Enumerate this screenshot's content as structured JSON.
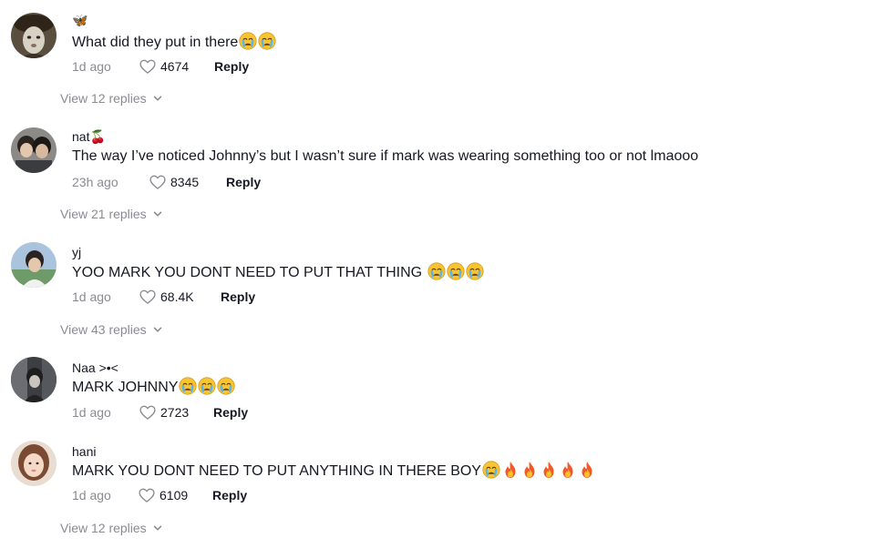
{
  "comments": [
    {
      "username": "🦋",
      "text": "What did they put in there",
      "emojis": [
        "cry-face",
        "cry-face"
      ],
      "time": "1d ago",
      "likes": "4674",
      "reply_label": "Reply",
      "view_replies": "View 12 replies"
    },
    {
      "username": "nat🍒",
      "text": "The way I’ve noticed Johnny’s but I wasn’t sure if mark was wearing something too or not lmaooo",
      "emojis": [],
      "time": "23h ago",
      "likes": "8345",
      "reply_label": "Reply",
      "view_replies": "View 21 replies"
    },
    {
      "username": "yj",
      "text": "YOO MARK YOU DONT NEED TO PUT THAT THING ",
      "emojis": [
        "cry-face",
        "cry-face",
        "cry-face"
      ],
      "time": "1d ago",
      "likes": "68.4K",
      "reply_label": "Reply",
      "view_replies": "View 43 replies"
    },
    {
      "username": "Naa >•<",
      "text": "MARK JOHNNY",
      "emojis": [
        "cry-face",
        "cry-face",
        "cry-face"
      ],
      "time": "1d ago",
      "likes": "2723",
      "reply_label": "Reply",
      "view_replies": ""
    },
    {
      "username": "hani",
      "text": "MARK YOU DONT NEED TO PUT ANYTHING IN THERE BOY",
      "emojis": [
        "cry-face",
        "fire",
        "fire",
        "fire",
        "fire",
        "fire"
      ],
      "time": "1d ago",
      "likes": "6109",
      "reply_label": "Reply",
      "view_replies": "View 12 replies"
    }
  ],
  "colors": {
    "text": "#161823",
    "muted": "#8a8b91",
    "background": "#ffffff"
  }
}
